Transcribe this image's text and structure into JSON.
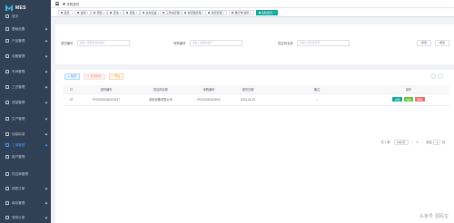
{
  "app": {
    "logo_text": "MES"
  },
  "topbar": {
    "breadcrumb": "采购退货"
  },
  "sidebar": {
    "items": [
      {
        "label": "首页",
        "icon": "home-icon",
        "has_children": false
      },
      {
        "label": "基础设置",
        "icon": "settings-icon",
        "has_children": true
      },
      {
        "label": "产品管理",
        "icon": "product-icon",
        "has_children": true
      },
      {
        "label": "设备管理",
        "icon": "device-icon",
        "has_children": true
      },
      {
        "label": "车间管理",
        "icon": "workshop-icon",
        "has_children": true
      },
      {
        "label": "工艺管理",
        "icon": "process-icon",
        "has_children": true
      },
      {
        "label": "质量管理",
        "icon": "quality-icon",
        "has_children": true
      },
      {
        "label": "生产管理",
        "icon": "production-icon",
        "has_children": true
      },
      {
        "label": "包装标准",
        "icon": "package-icon",
        "has_children": true
      },
      {
        "label": "工单管理",
        "icon": "workorder-icon",
        "has_children": true
      },
      {
        "label": "客户管理",
        "icon": "customer-icon",
        "has_children": false
      },
      {
        "label": "供应商管理",
        "icon": "supplier-icon",
        "has_children": false
      },
      {
        "label": "销售订单",
        "icon": "sales-icon",
        "has_children": true
      },
      {
        "label": "库存管理",
        "icon": "stock-icon",
        "has_children": true
      },
      {
        "label": "采购订单",
        "icon": "purchase-icon",
        "has_children": true
      }
    ]
  },
  "tags": [
    {
      "label": "首页",
      "active": false
    },
    {
      "label": "金库",
      "active": false
    },
    {
      "label": "预警",
      "active": false
    },
    {
      "label": "查询",
      "active": false
    },
    {
      "label": "模板",
      "active": false
    },
    {
      "label": "失效设备",
      "active": false
    },
    {
      "label": "工作站管理",
      "active": false
    },
    {
      "label": "物流路管理",
      "active": false
    },
    {
      "label": "物流管理",
      "active": false
    },
    {
      "label": "推行单 退料",
      "active": false
    },
    {
      "label": "采购退货",
      "active": true
    }
  ],
  "search": {
    "fields": [
      {
        "label": "退货编号",
        "placeholder": "请输入采购退货单编号"
      },
      {
        "label": "采购编号",
        "placeholder": "请输入采购单编号"
      },
      {
        "label": "供应商名称",
        "placeholder": "请输入供应商名称"
      }
    ],
    "search_label": "搜索",
    "reset_label": "重置"
  },
  "toolbar": {
    "add_label": "新增",
    "delete_label": "批量删除",
    "export_label": "导出"
  },
  "table": {
    "columns": [
      "退货编号",
      "供应商名称",
      "采购编号",
      "退货日期",
      "备注",
      "操作"
    ],
    "rows": [
      {
        "return_no": "PCRJS20240420237",
        "supplier": "锦和设备有限公司",
        "purchase_no": "PEJ20240423004",
        "date": "2024-04-23",
        "remark": "--",
        "ops": [
          "详情",
          "修改",
          "删除"
        ]
      }
    ]
  },
  "pager": {
    "total": "共 1 条",
    "page_size": "10条/页",
    "prev": "‹",
    "current": "1",
    "next": "›",
    "goto_label": "前往",
    "goto_value": "1",
    "page_suffix": "页"
  },
  "watermark": {
    "left": "头条号",
    "right": "源码宝"
  }
}
